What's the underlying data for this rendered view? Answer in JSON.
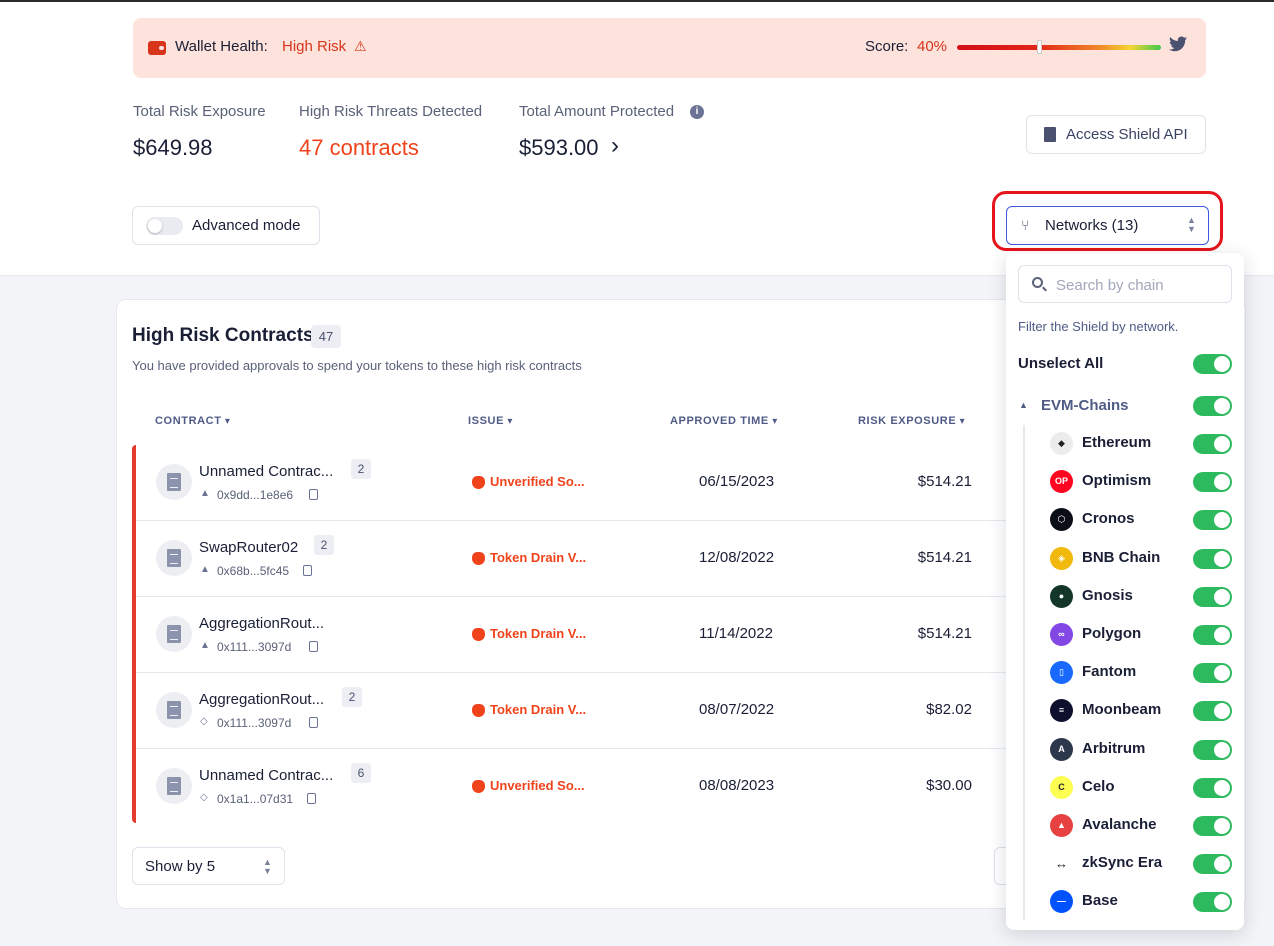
{
  "health": {
    "label": "Wallet Health:",
    "status": "High Risk",
    "score_label": "Score:",
    "score_value": "40%",
    "score_fraction": 0.4
  },
  "stats": {
    "exposure_label": "Total Risk Exposure",
    "exposure_value": "$649.98",
    "threats_label": "High Risk Threats Detected",
    "threats_value": "47 contracts",
    "protected_label": "Total Amount Protected",
    "protected_value": "$593.00"
  },
  "actions": {
    "api_button": "Access Shield API",
    "advanced_mode": "Advanced mode",
    "networks_button": "Networks (13)"
  },
  "contracts": {
    "title": "High Risk Contracts",
    "count": "47",
    "subtitle": "You have provided approvals to spend your tokens to these high risk contracts",
    "columns": [
      "CONTRACT",
      "ISSUE",
      "APPROVED TIME",
      "RISK EXPOSURE"
    ],
    "rows": [
      {
        "name": "Unnamed Contrac...",
        "badge": "2",
        "address": "0x9dd...1e8e6",
        "issue": "Unverified So...",
        "date": "06/15/2023",
        "amount": "$514.21"
      },
      {
        "name": "SwapRouter02",
        "badge": "2",
        "address": "0x68b...5fc45",
        "issue": "Token Drain V...",
        "date": "12/08/2022",
        "amount": "$514.21"
      },
      {
        "name": "AggregationRout...",
        "badge": "",
        "address": "0x111...3097d",
        "issue": "Token Drain V...",
        "date": "11/14/2022",
        "amount": "$514.21"
      },
      {
        "name": "AggregationRout...",
        "badge": "2",
        "address": "0x111...3097d",
        "issue": "Token Drain V...",
        "date": "08/07/2022",
        "amount": "$82.02"
      },
      {
        "name": "Unnamed Contrac...",
        "badge": "6",
        "address": "0x1a1...07d31",
        "issue": "Unverified So...",
        "date": "08/08/2023",
        "amount": "$30.00"
      }
    ],
    "show_by": "Show by 5"
  },
  "network_panel": {
    "search_placeholder": "Search by chain",
    "description": "Filter the Shield by network.",
    "unselect_all": "Unselect All",
    "group": "EVM-Chains",
    "chains": [
      {
        "name": "Ethereum",
        "icon": "ethereum-icon",
        "color": "#ececec",
        "glyph": "◆"
      },
      {
        "name": "Optimism",
        "icon": "optimism-icon",
        "color": "#ff0420",
        "glyph": "OP"
      },
      {
        "name": "Cronos",
        "icon": "cronos-icon",
        "color": "#0b0e17",
        "glyph": "⬡"
      },
      {
        "name": "BNB Chain",
        "icon": "bnb-icon",
        "color": "#f0b90b",
        "glyph": "◈"
      },
      {
        "name": "Gnosis",
        "icon": "gnosis-icon",
        "color": "#133629",
        "glyph": "●"
      },
      {
        "name": "Polygon",
        "icon": "polygon-icon",
        "color": "#8247e5",
        "glyph": "∞"
      },
      {
        "name": "Fantom",
        "icon": "fantom-icon",
        "color": "#1969ff",
        "glyph": "▯"
      },
      {
        "name": "Moonbeam",
        "icon": "moonbeam-icon",
        "color": "#0d0f2c",
        "glyph": "≡"
      },
      {
        "name": "Arbitrum",
        "icon": "arbitrum-icon",
        "color": "#2d374b",
        "glyph": "A"
      },
      {
        "name": "Celo",
        "icon": "celo-icon",
        "color": "#fcff52",
        "glyph": "C"
      },
      {
        "name": "Avalanche",
        "icon": "avalanche-icon",
        "color": "#e84142",
        "glyph": "▲"
      },
      {
        "name": "zkSync Era",
        "icon": "zksync-icon",
        "color": "#ffffff",
        "glyph": "↔"
      },
      {
        "name": "Base",
        "icon": "base-icon",
        "color": "#0052ff",
        "glyph": "—"
      }
    ]
  },
  "colors": {
    "risk": "#d7341c",
    "accent": "#3d5ae0",
    "toggle_on": "#2dba5e",
    "row_border": "#e53b2c"
  }
}
